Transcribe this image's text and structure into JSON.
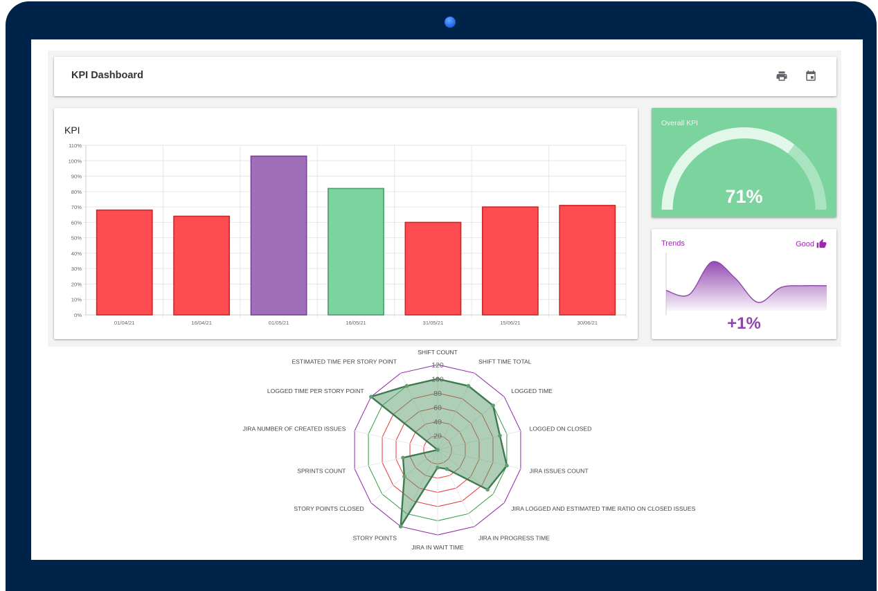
{
  "header": {
    "title": "KPI Dashboard",
    "print_icon": "print-icon",
    "calendar_icon": "calendar-icon"
  },
  "kpi_chart": {
    "title": "KPI"
  },
  "overall": {
    "label": "Overall KPI",
    "value": "71%",
    "gauge_fraction": 0.71,
    "colors": {
      "background": "#7bd39e",
      "track": "#a9e3bf",
      "fill": "#e3f6ea"
    }
  },
  "trends": {
    "label": "Trends",
    "status": "Good",
    "status_icon": "thumb-up-icon",
    "value": "+1%"
  },
  "colors": {
    "bar_red": "#ff4c51",
    "bar_red_border": "#c62828",
    "bar_purple": "#a06fba",
    "bar_purple_border": "#7b3f9e",
    "bar_green": "#7bd39e",
    "bar_green_border": "#4c9c6a",
    "radar_fill": "#5e9e70",
    "radar_line": "#3e7a4f",
    "accent_purple": "#9c27b0"
  },
  "chart_data": [
    {
      "type": "bar",
      "title": "KPI",
      "categories": [
        "01/04/21",
        "16/04/21",
        "01/05/21",
        "16/05/21",
        "31/05/21",
        "15/06/21",
        "30/06/21"
      ],
      "values": [
        68,
        64,
        103,
        82,
        60,
        70,
        71
      ],
      "bar_colors": [
        "red",
        "red",
        "purple",
        "green",
        "red",
        "red",
        "red"
      ],
      "yticks": [
        "0%",
        "10%",
        "20%",
        "30%",
        "40%",
        "50%",
        "60%",
        "70%",
        "80%",
        "90%",
        "100%",
        "110%"
      ],
      "ylim": [
        0,
        110
      ],
      "grid": true
    },
    {
      "type": "area",
      "title": "",
      "x": [
        0,
        1,
        2,
        3,
        4,
        5,
        6,
        7
      ],
      "values": [
        0.34,
        0.27,
        0.82,
        0.55,
        0.14,
        0.39,
        0.42,
        0.42
      ]
    },
    {
      "type": "radar",
      "axes": [
        "SHIFT COUNT",
        "SHIFT TIME TOTAL",
        "LOGGED TIME",
        "LOGGED ON CLOSED",
        "JIRA ISSUES COUNT",
        "JIRA LOGGED AND ESTIMATED TIME RATIO ON CLOSED ISSUES",
        "JIRA IN PROGRESS TIME",
        "JIRA IN WAIT TIME",
        "STORY POINTS",
        "STORY POINTS CLOSED",
        "SPRINTS COUNT",
        "JIRA NUMBER OF CREATED ISSUES",
        "LOGGED TIME PER STORY POINT",
        "ESTIMATED TIME PER STORY POINT"
      ],
      "ticks": [
        "20",
        "40",
        "60",
        "80",
        "100",
        "120"
      ],
      "values": [
        100,
        100,
        100,
        90,
        100,
        90,
        30,
        25,
        120,
        60,
        50,
        0,
        120,
        100
      ],
      "rmax": 120
    }
  ]
}
